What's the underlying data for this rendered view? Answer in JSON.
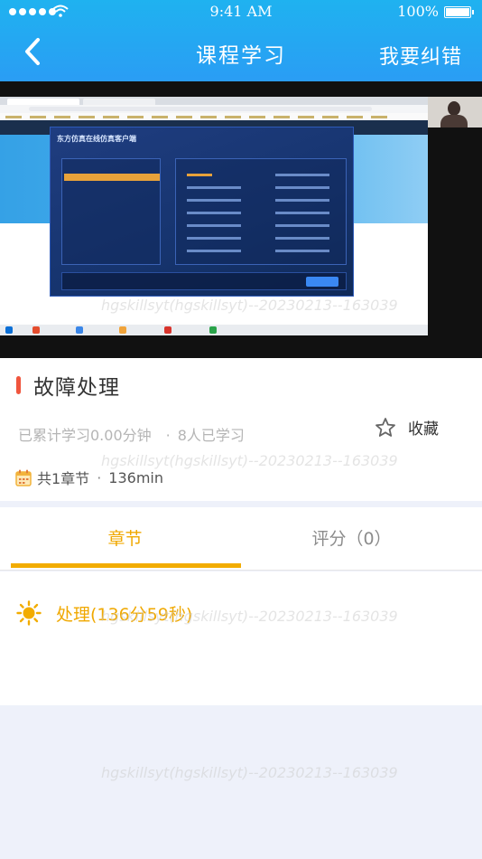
{
  "status_bar": {
    "time": "9:41 AM",
    "battery": "100%"
  },
  "header": {
    "title": "课程学习",
    "report_label": "我要纠错"
  },
  "video": {
    "dialog_title": "东方仿真在线仿真客户端"
  },
  "course": {
    "title": "故障处理",
    "study_time": "已累计学习0.00分钟",
    "learners": "8人已学习",
    "favorite_label": "收藏",
    "chapter_count": "共1章节",
    "duration": "136min"
  },
  "tabs": {
    "chapter": "章节",
    "rating": "评分（0）"
  },
  "chapters": [
    {
      "label": "处理(136分59秒)"
    }
  ],
  "watermark": "hgskillsyt(hgskillsyt)--20230213--163039",
  "colors": {
    "accent": "#f0a800",
    "header": "#1fb2f0",
    "title_bar": "#f0553d"
  },
  "icons": [
    "back-icon",
    "star-icon",
    "calendar-icon",
    "sun-chapter-icon"
  ]
}
